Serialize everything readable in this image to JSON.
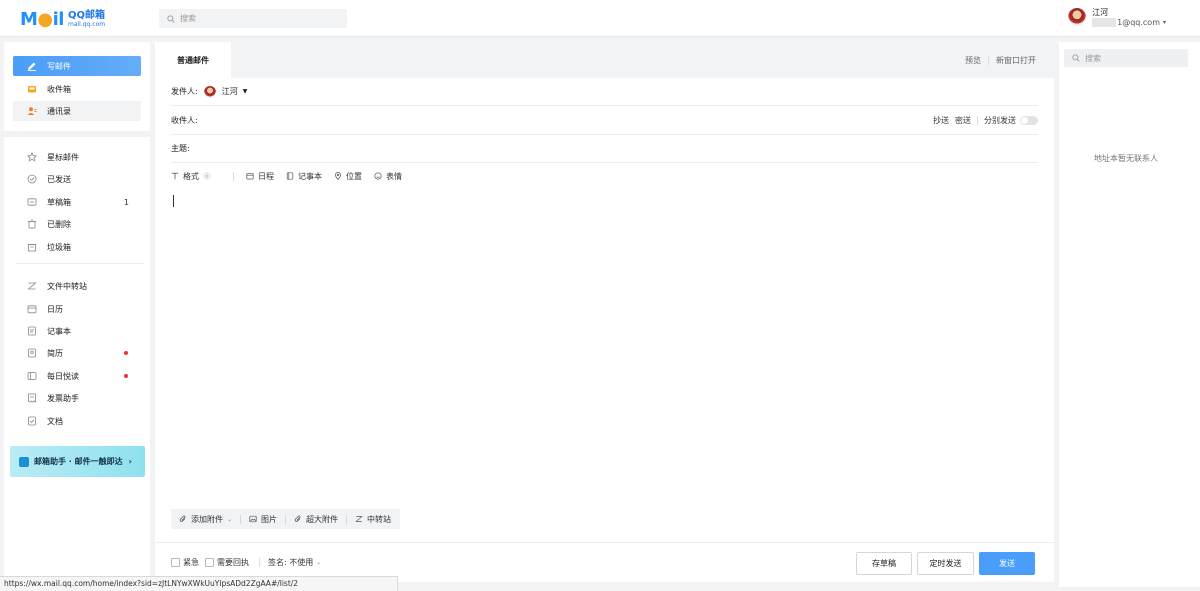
{
  "header": {
    "logo_text_a": "QQ邮箱",
    "logo_text_b": "mail.qq.com",
    "search_placeholder": "搜索",
    "user_name": "江河",
    "user_email_suffix": "1@qq.com"
  },
  "sidebar": {
    "compose": "写邮件",
    "primary": [
      {
        "label": "收件箱",
        "icon": "inbox-icon"
      },
      {
        "label": "通讯录",
        "icon": "contacts-icon"
      }
    ],
    "folders": [
      {
        "label": "星标邮件",
        "icon": "star-icon"
      },
      {
        "label": "已发送",
        "icon": "sent-icon"
      },
      {
        "label": "草稿箱",
        "icon": "draft-icon",
        "count": "1"
      },
      {
        "label": "已删除",
        "icon": "trash-icon"
      },
      {
        "label": "垃圾箱",
        "icon": "spam-icon"
      }
    ],
    "apps": [
      {
        "label": "文件中转站",
        "icon": "transfer-icon"
      },
      {
        "label": "日历",
        "icon": "calendar-icon"
      },
      {
        "label": "记事本",
        "icon": "notepad-icon"
      },
      {
        "label": "简历",
        "icon": "resume-icon",
        "dot": true
      },
      {
        "label": "每日悦读",
        "icon": "reading-icon",
        "dot": true
      },
      {
        "label": "发票助手",
        "icon": "invoice-icon"
      },
      {
        "label": "文档",
        "icon": "doc-icon"
      }
    ],
    "promo": "邮箱助手 · 邮件一触即达"
  },
  "compose": {
    "tab": "普通邮件",
    "preview": "预览",
    "new_window": "新窗口打开",
    "from_label": "发件人:",
    "from_name": "江河",
    "to_label": "收件人:",
    "cc": "抄送",
    "bcc": "密送",
    "separate_send": "分别发送",
    "subject_label": "主题:",
    "toolbar": {
      "format": "格式",
      "schedule": "日程",
      "notepad": "记事本",
      "location": "位置",
      "emoji": "表情"
    },
    "attach": {
      "add_attachment": "添加附件",
      "image": "图片",
      "large_attachment": "超大附件",
      "transfer": "中转站"
    },
    "footer": {
      "urgent": "紧急",
      "receipt": "需要回执",
      "signature": "签名: 不使用",
      "save_draft": "存草稿",
      "timed_send": "定时发送",
      "send": "发送"
    }
  },
  "right_panel": {
    "search_placeholder": "搜索",
    "empty_text": "地址本暂无联系人"
  },
  "status_url": "https://wx.mail.qq.com/home/index?sid=zJtLNYwXWkUuYlpsADd2ZgAA#/list/2",
  "colors": {
    "accent": "#4a9df8",
    "background": "#f2f3f5",
    "dot": "#ee3333"
  }
}
